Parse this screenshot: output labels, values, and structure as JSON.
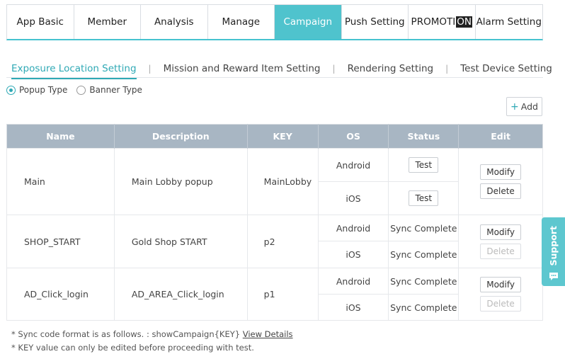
{
  "tabs": [
    {
      "label": "App Basic"
    },
    {
      "label": "Member"
    },
    {
      "label": "Analysis"
    },
    {
      "label": "Manage"
    },
    {
      "label": "Campaign",
      "active": true
    },
    {
      "label": "Push Setting"
    },
    {
      "label_prefix": "PROMOTI",
      "label_highlight": "ON"
    },
    {
      "label": "Alarm Setting"
    }
  ],
  "subtabs": [
    {
      "label": "Exposure Location Setting",
      "active": true
    },
    {
      "label": "Mission and Reward Item Setting"
    },
    {
      "label": "Rendering Setting"
    },
    {
      "label": "Test Device Setting"
    }
  ],
  "radios": [
    {
      "label": "Popup Type",
      "checked": true
    },
    {
      "label": "Banner Type",
      "checked": false
    }
  ],
  "add_button": {
    "label": "Add"
  },
  "table": {
    "headers": [
      "Name",
      "Description",
      "KEY",
      "OS",
      "Status",
      "Edit"
    ],
    "rows": [
      {
        "name": "Main",
        "description": "Main Lobby popup",
        "key": "MainLobby",
        "entries": [
          {
            "os": "Android",
            "status_button": "Test",
            "edit": "Modify"
          },
          {
            "os": "iOS",
            "status_button": "Test",
            "edit": "Delete"
          }
        ]
      },
      {
        "name": "SHOP_START",
        "description": "Gold Shop START",
        "key": "p2",
        "entries": [
          {
            "os": "Android",
            "status": "Sync Complete",
            "edit": "Modify"
          },
          {
            "os": "iOS",
            "status": "Sync Complete",
            "edit": "Delete"
          }
        ]
      },
      {
        "name": "AD_Click_login",
        "description": "AD_AREA_Click_login",
        "key": "p1",
        "entries": [
          {
            "os": "Android",
            "status": "Sync Complete",
            "edit": "Modify"
          },
          {
            "os": "iOS",
            "status": "Sync Complete",
            "edit": "Delete"
          }
        ]
      }
    ]
  },
  "notes": {
    "line1": "* Sync code format is as follows. : showCampaign{KEY}",
    "line1_link": "View Details",
    "line2": "* KEY value can only be edited before proceeding with test."
  },
  "support": {
    "label": "Support",
    "icon": "chat-icon"
  },
  "colors": {
    "accent": "#4fc3cd",
    "header_bg": "#a8b6c3",
    "active_text": "#2fa9b5"
  }
}
